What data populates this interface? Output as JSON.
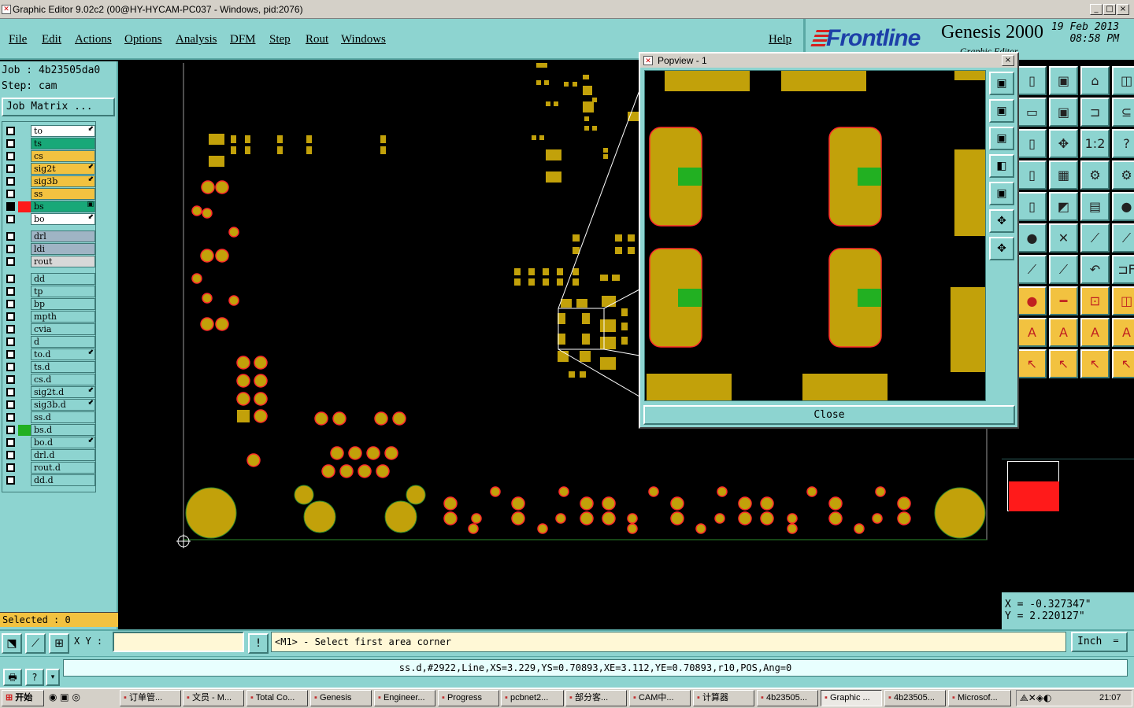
{
  "window": {
    "title": "Graphic Editor 9.02c2 (00@HY-HYCAM-PC037 - Windows, pid:2076)",
    "minimize": "_",
    "maximize": "□",
    "close": "×"
  },
  "menu": {
    "file": "File",
    "edit": "Edit",
    "actions": "Actions",
    "options": "Options",
    "analysis": "Analysis",
    "dfm": "DFM",
    "step": "Step",
    "rout": "Rout",
    "windows": "Windows",
    "help": "Help"
  },
  "brand": {
    "logo": "Frontline",
    "product": "Genesis 2000",
    "date": "19 Feb 2013",
    "time": "08:58 PM",
    "subtitle": "Graphic Editor"
  },
  "job": {
    "job_line": "Job : 4b23505da0",
    "step_line": "Step: cam",
    "matrix_button": "Job Matrix ..."
  },
  "layers": [
    {
      "name": "to",
      "color": "#ffffff",
      "arrow": "⬋"
    },
    {
      "name": "ts",
      "color": "#18a878",
      "arrow": ""
    },
    {
      "name": "cs",
      "color": "#f2c240",
      "arrow": ""
    },
    {
      "name": "sig2t",
      "color": "#f2c240",
      "arrow": "⬋"
    },
    {
      "name": "sig3b",
      "color": "#f2c240",
      "arrow": "⬋"
    },
    {
      "name": "ss",
      "color": "#f2c240",
      "arrow": ""
    },
    {
      "name": "bs",
      "color": "#18a878",
      "arrow": "▣",
      "swatch": "#ff1a1a",
      "checked": true
    },
    {
      "name": "bo",
      "color": "#ffffff",
      "arrow": "⬋"
    },
    {
      "name": "drl",
      "color": "#9fb4c4",
      "arrow": ""
    },
    {
      "name": "ldi",
      "color": "#9fb4c4",
      "arrow": ""
    },
    {
      "name": "rout",
      "color": "#d8d8d8",
      "arrow": ""
    },
    {
      "name": "dd",
      "color": "#8dd4d0",
      "arrow": ""
    },
    {
      "name": "tp",
      "color": "#8dd4d0",
      "arrow": ""
    },
    {
      "name": "bp",
      "color": "#8dd4d0",
      "arrow": ""
    },
    {
      "name": "mpth",
      "color": "#8dd4d0",
      "arrow": ""
    },
    {
      "name": "cvia",
      "color": "#8dd4d0",
      "arrow": ""
    },
    {
      "name": "d",
      "color": "#8dd4d0",
      "arrow": ""
    },
    {
      "name": "to.d",
      "color": "#8dd4d0",
      "arrow": "⬋"
    },
    {
      "name": "ts.d",
      "color": "#8dd4d0",
      "arrow": ""
    },
    {
      "name": "cs.d",
      "color": "#8dd4d0",
      "arrow": ""
    },
    {
      "name": "sig2t.d",
      "color": "#8dd4d0",
      "arrow": "⬋"
    },
    {
      "name": "sig3b.d",
      "color": "#8dd4d0",
      "arrow": "⬋"
    },
    {
      "name": "ss.d",
      "color": "#8dd4d0",
      "arrow": ""
    },
    {
      "name": "bs.d",
      "color": "#8dd4d0",
      "arrow": "",
      "swatch": "#22b022"
    },
    {
      "name": "bo.d",
      "color": "#8dd4d0",
      "arrow": "⬋"
    },
    {
      "name": "drl.d",
      "color": "#8dd4d0",
      "arrow": ""
    },
    {
      "name": "rout.d",
      "color": "#8dd4d0",
      "arrow": ""
    },
    {
      "name": "dd.d",
      "color": "#8dd4d0",
      "arrow": ""
    }
  ],
  "selected": "Selected : 0",
  "popview": {
    "title": "Popview - 1",
    "close_label": "Close"
  },
  "coords": {
    "x": "X = -0.327347\"",
    "y": "Y = 2.220127\""
  },
  "command": {
    "xy_label": "X Y :",
    "xy_value": "",
    "prompt": "<M1> - Select first area corner",
    "unit": "Inch"
  },
  "status": "ss.d,#2922,Line,XS=3.229,YS=0.70893,XE=3.112,YE=0.70893,r10,POS,Ang=0",
  "taskbar": {
    "start": "开始",
    "tasks": [
      "订单管...",
      "文员 - M...",
      "Total Co...",
      "Genesis",
      "Engineer...",
      "Progress",
      "pcbnet2...",
      "部分客...",
      "CAM中...",
      "计算器",
      "4b23505...",
      "Graphic ...",
      "4b23505...",
      "Microsof..."
    ],
    "clock": "21:07"
  },
  "colors": {
    "pad": "#c2a10a",
    "pad_outline": "#ff2a2a",
    "panel": "#8dd4d0",
    "highlight": "#ff1a1a",
    "solder": "#22b022"
  }
}
